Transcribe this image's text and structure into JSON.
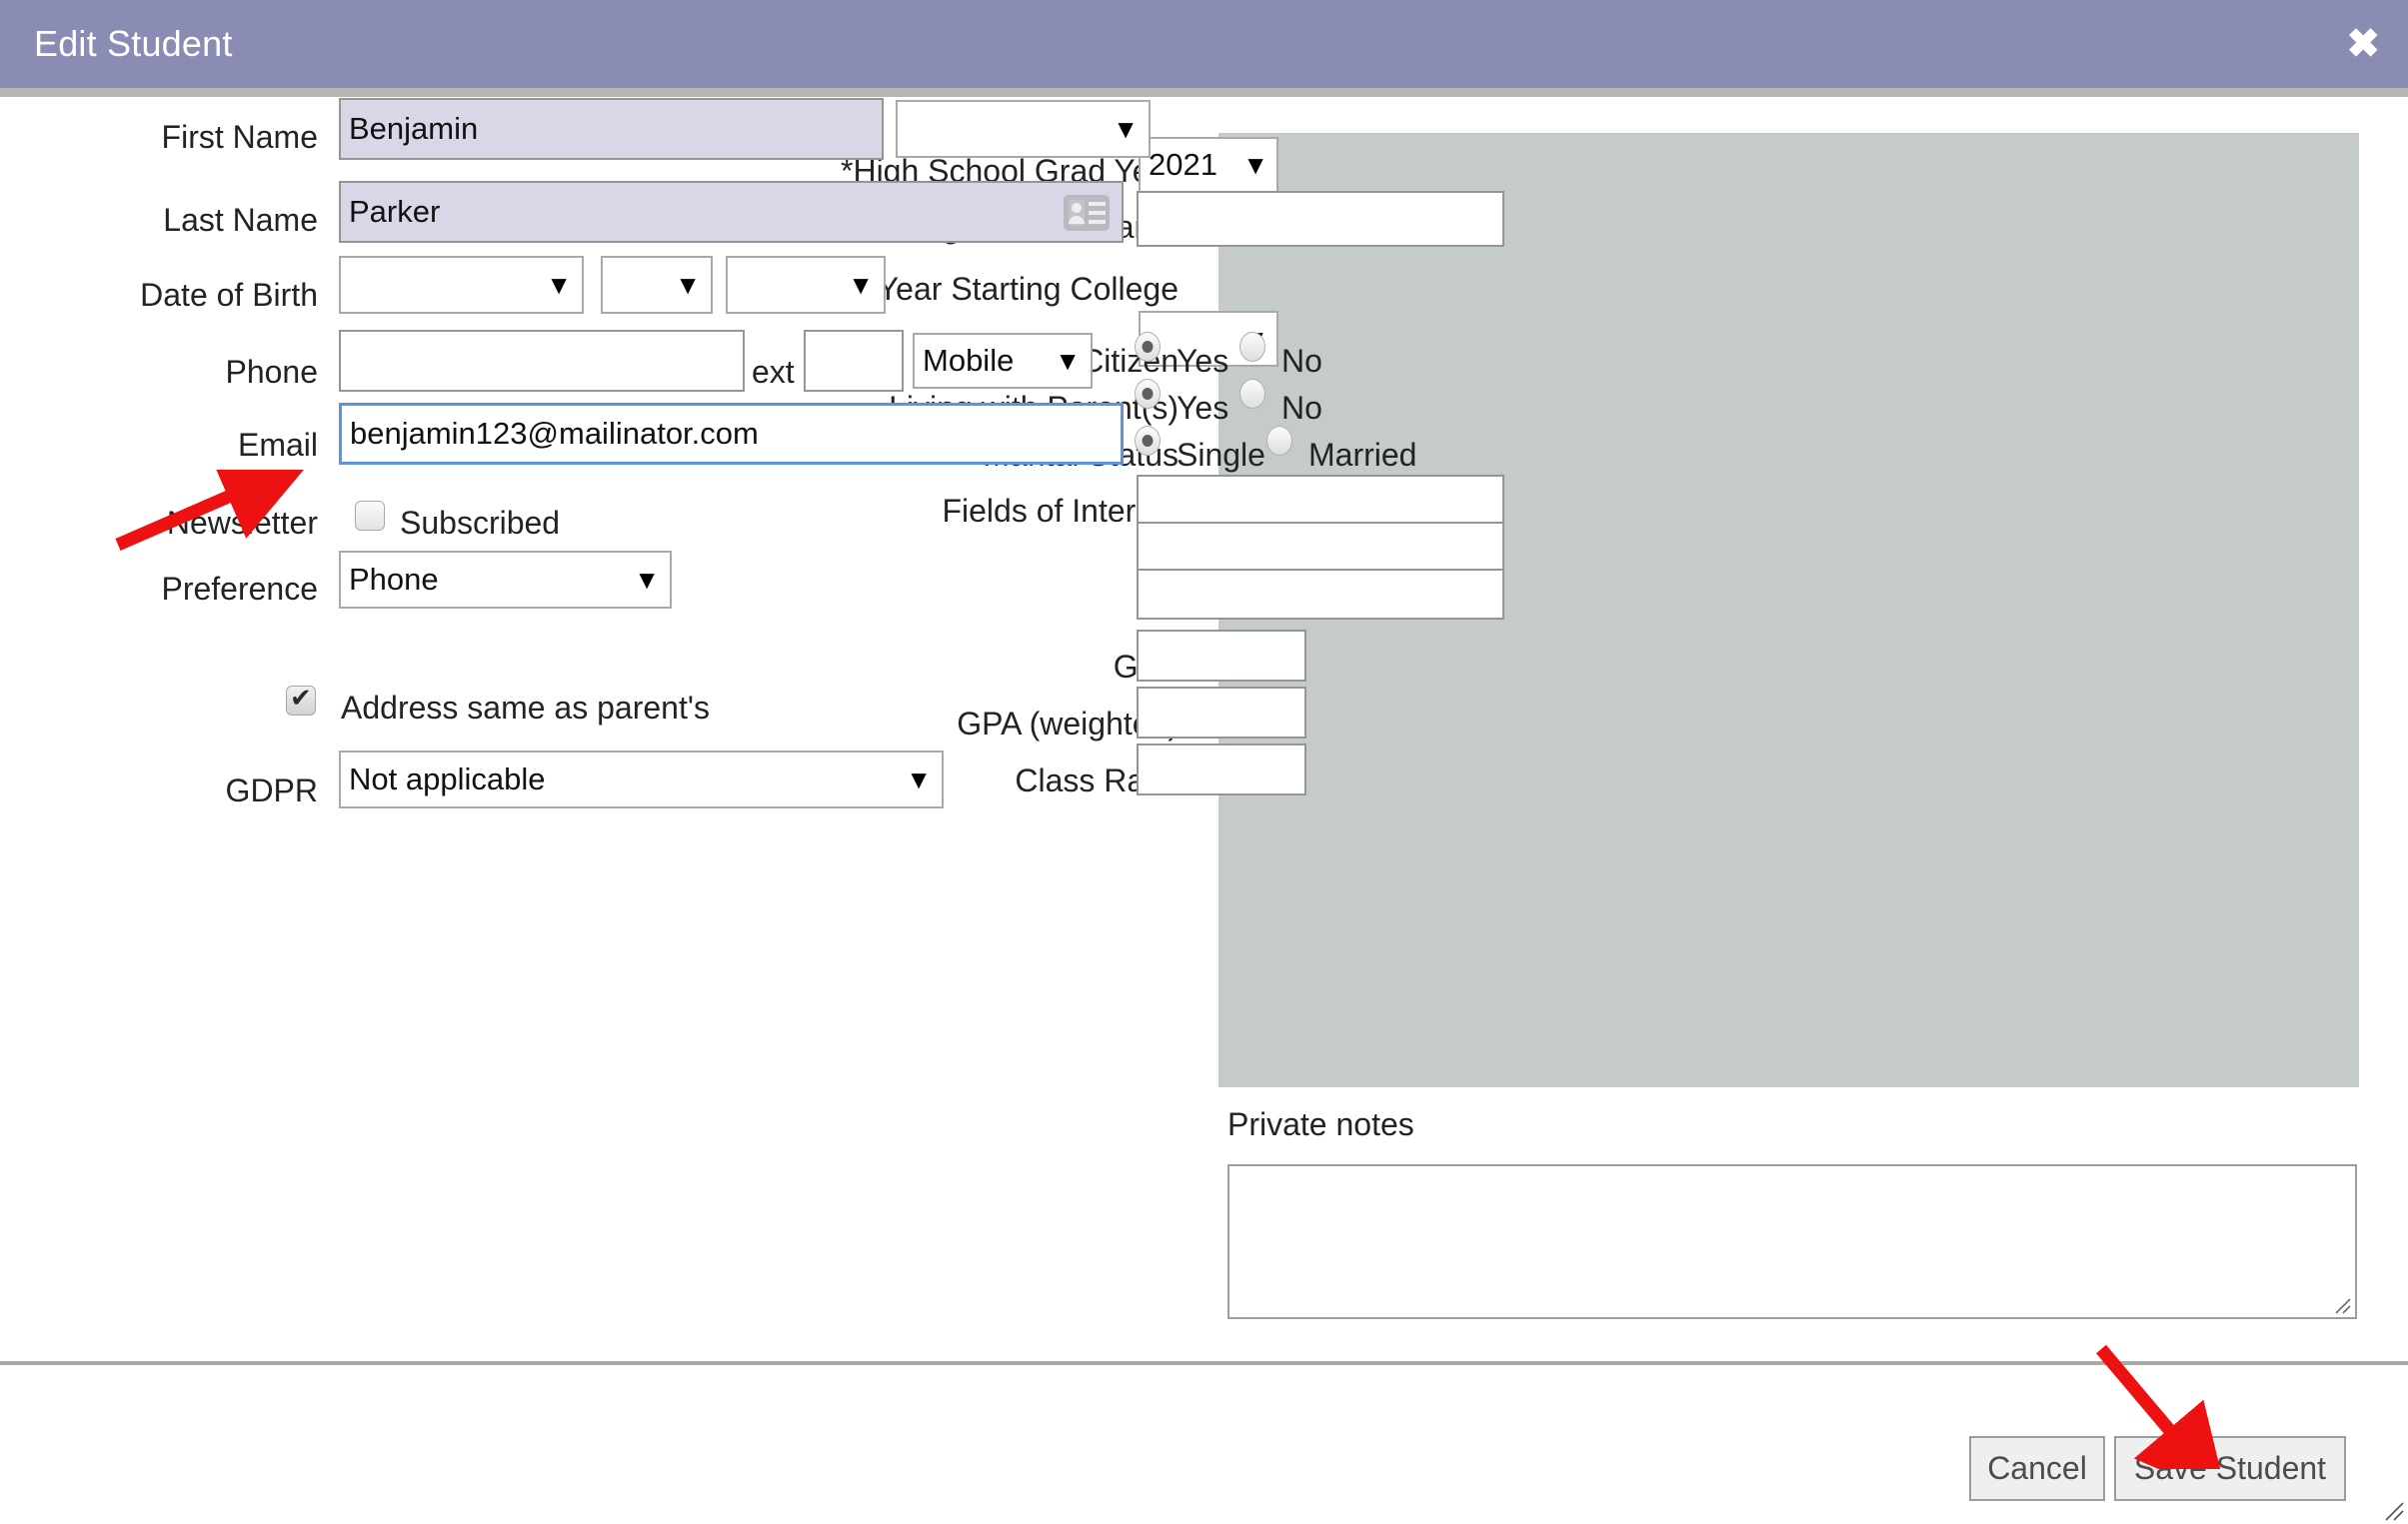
{
  "window": {
    "title": "Edit Student",
    "close_icon": "close-icon",
    "close_glyph": "✖",
    "header_color": "#8b8cb4"
  },
  "colors": {
    "header": "#8b8cb4",
    "right_panel": "#c4cbca",
    "autofill": "#d7d7e7",
    "focus_border": "#5c92e8",
    "annotation_arrow": "#ee1111"
  },
  "left_form": {
    "first_name": {
      "label": "First Name",
      "value": "Benjamin",
      "placeholder": "",
      "suffix_select": {
        "value": "",
        "caret": "▼"
      }
    },
    "last_name": {
      "label": "Last Name",
      "value": "Parker",
      "placeholder": "",
      "icon": "contact-card-icon"
    },
    "date_of_birth": {
      "label": "Date of Birth",
      "month": {
        "value": "",
        "caret": "▼"
      },
      "day": {
        "value": "",
        "caret": "▼"
      },
      "year": {
        "value": "",
        "caret": "▼"
      }
    },
    "phone": {
      "label": "Phone",
      "number": "",
      "ext_label": "ext",
      "ext_value": "",
      "type": {
        "value": "Mobile",
        "caret": "▼"
      }
    },
    "email": {
      "label": "Email",
      "value": "benjamin123@mailinator.com",
      "placeholder": "",
      "focused": true
    },
    "newsletter": {
      "label": "Newsletter",
      "checkbox_label": "Subscribed",
      "checked": false
    },
    "preference": {
      "label": "Preference",
      "value": "Phone",
      "caret": "▼"
    },
    "address_same": {
      "checkbox_label": "Address same as parent's",
      "checked": true
    },
    "gdpr": {
      "label": "GDPR",
      "value": "Not applicable",
      "caret": "▼"
    }
  },
  "right_form": {
    "grad_year": {
      "label": "*High School Grad Year",
      "value": "2021",
      "caret": "▼"
    },
    "high_school_name": {
      "label": "High School Name",
      "value": ""
    },
    "year_starting_college": {
      "label": "Year Starting College",
      "value": "",
      "caret": "▼"
    },
    "us_citizen": {
      "label": "US Citizen",
      "options": [
        "Yes",
        "No"
      ],
      "selected": "Yes"
    },
    "living_with_parents": {
      "label": "Living with Parent(s)",
      "options": [
        "Yes",
        "No"
      ],
      "selected": "Yes"
    },
    "marital_status": {
      "label": "Marital Status",
      "options": [
        "Single",
        "Married"
      ],
      "selected": "Single"
    },
    "fields_of_interest": {
      "label": "Fields of Interest",
      "values": [
        "",
        "",
        ""
      ]
    },
    "gpa": {
      "label": "GPA",
      "value": ""
    },
    "gpa_weighted": {
      "label": "GPA (weighted)",
      "value": ""
    },
    "class_rank": {
      "label": "Class Rank",
      "value": ""
    }
  },
  "private_notes": {
    "label": "Private notes",
    "value": "",
    "placeholder": ""
  },
  "footer": {
    "cancel_label": "Cancel",
    "save_label": "Save Student"
  },
  "annotations": [
    {
      "name": "arrow-pointing-to-email-field",
      "target": "email"
    },
    {
      "name": "arrow-pointing-to-save-button",
      "target": "save-button"
    }
  ]
}
